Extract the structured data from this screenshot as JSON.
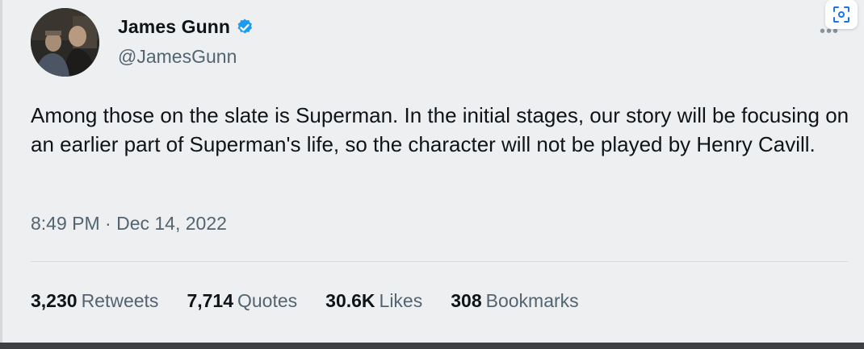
{
  "author": {
    "display_name": "James Gunn",
    "handle": "@JamesGunn",
    "verified": true,
    "verified_color": "#1d9bf0"
  },
  "tweet": {
    "text": "Among those on the slate is Superman. In the initial stages, our story will be focusing on an earlier part of Superman's life, so the character will not be played by Henry Cavill.",
    "timestamp": "8:49 PM · Dec 14, 2022"
  },
  "stats": [
    {
      "value": "3,230",
      "label": "Retweets"
    },
    {
      "value": "7,714",
      "label": "Quotes"
    },
    {
      "value": "30.6K",
      "label": "Likes"
    },
    {
      "value": "308",
      "label": "Bookmarks"
    }
  ],
  "icons": {
    "more": "more-dots-icon",
    "lens": "visual-search-icon"
  },
  "colors": {
    "primary_text": "#0f1419",
    "secondary_text": "#536471",
    "background": "#eeeff1"
  }
}
